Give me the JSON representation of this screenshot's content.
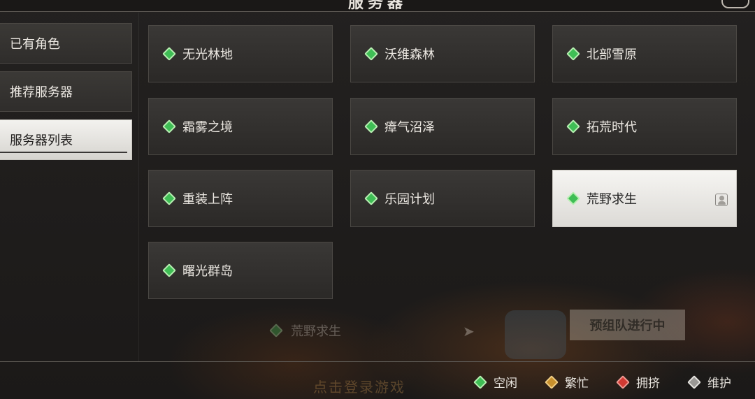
{
  "header": {
    "title": "服务器"
  },
  "tabs": [
    {
      "label": "已有角色",
      "active": false
    },
    {
      "label": "推荐服务器",
      "active": false
    },
    {
      "label": "服务器列表",
      "active": true
    }
  ],
  "servers": [
    {
      "name": "无光林地",
      "status": "idle"
    },
    {
      "name": "沃维森林",
      "status": "idle"
    },
    {
      "name": "北部雪原",
      "status": "idle"
    },
    {
      "name": "霜雾之境",
      "status": "idle"
    },
    {
      "name": "瘴气沼泽",
      "status": "idle"
    },
    {
      "name": "拓荒时代",
      "status": "idle"
    },
    {
      "name": "重装上阵",
      "status": "idle"
    },
    {
      "name": "乐园计划",
      "status": "idle"
    },
    {
      "name": "荒野求生",
      "status": "idle",
      "selected": true,
      "has_character_icon": "user-icon"
    },
    {
      "name": "曙光群岛",
      "status": "idle"
    }
  ],
  "background": {
    "server_name": "荒野求生",
    "team_button": "预组队进行中",
    "start_text": "点击登录游戏"
  },
  "legend": [
    {
      "label": "空闲",
      "color": "#3fbe55"
    },
    {
      "label": "繁忙",
      "color": "#c7902d"
    },
    {
      "label": "拥挤",
      "color": "#d23a33"
    },
    {
      "label": "维护",
      "color": "#9a9895"
    }
  ]
}
